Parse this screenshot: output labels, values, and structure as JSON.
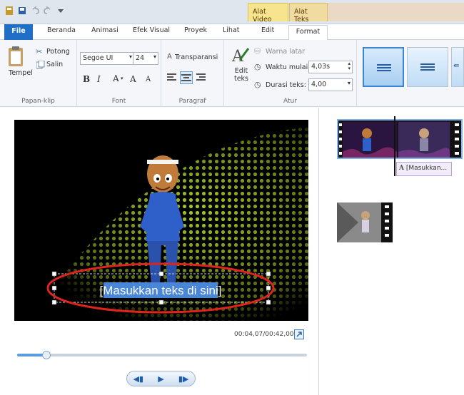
{
  "contextual_tabs": {
    "video": "Alat Video",
    "text": "Alat Teks"
  },
  "tabs": [
    "File",
    "Beranda",
    "Animasi",
    "Efek Visual",
    "Proyek",
    "Lihat",
    "Edit",
    "Format"
  ],
  "ribbon": {
    "clipboard": {
      "paste": "Tempel",
      "cut": "Potong",
      "copy": "Salin",
      "group_label": "Papan-klip"
    },
    "font": {
      "family": "Segoe UI",
      "size": "24",
      "bold": "B",
      "italic": "I",
      "font_color": "A",
      "grow": "A",
      "shrink": "A",
      "group_label": "Font"
    },
    "paragraph": {
      "transparency": "Transparansi",
      "group_label": "Paragraf"
    },
    "adjust": {
      "edit_text": "Edit teks",
      "background_color": "Warna latar",
      "start_time_label": "Waktu mulai:",
      "start_time_value": "4,03s",
      "duration_label": "Durasi teks:",
      "duration_value": "4,00",
      "group_label": "Atur"
    }
  },
  "preview": {
    "caption_text": "[Masukkan teks di sini]"
  },
  "playback": {
    "time": "00:04,07/00:42,00",
    "progress": 0.1
  },
  "timeline": {
    "caption_clip_label": "[Masukkan..."
  },
  "colors": {
    "file_tab": "#1f6fc6",
    "accent": "#3a86d6",
    "annotation_ellipse": "#e0241c",
    "caption_highlight": "#4a86d8"
  }
}
